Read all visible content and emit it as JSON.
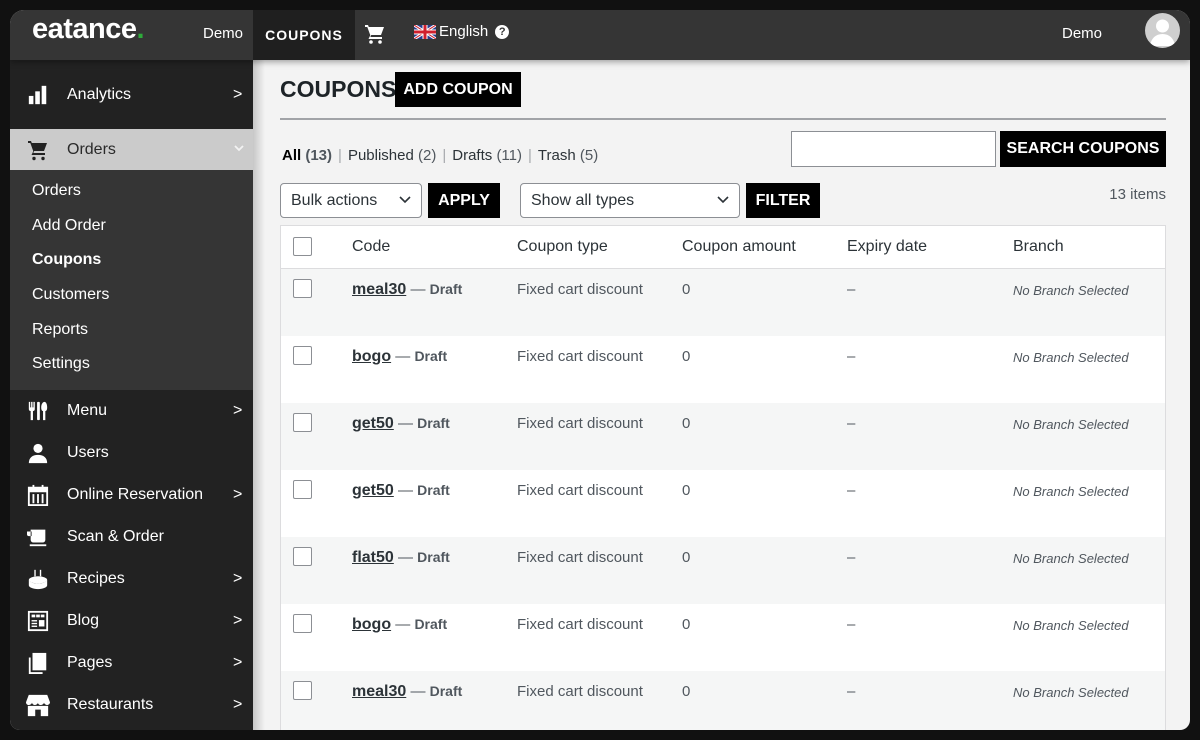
{
  "topbar": {
    "logo_text": "eatance",
    "logo_dot": ".",
    "site_name": "Demo",
    "active_tab": "COUPONS",
    "cart_icon": "cart-icon",
    "language": "English",
    "help_icon": "?",
    "user_name": "Demo",
    "avatar_icon": "user-avatar-icon"
  },
  "sidebar": {
    "items": [
      {
        "label": "Analytics",
        "icon": "bar-chart-icon",
        "has_chevron": true
      },
      {
        "label": "Orders",
        "icon": "cart-icon",
        "expanded": true
      },
      {
        "label": "Menu",
        "icon": "utensils-icon",
        "has_chevron": true
      },
      {
        "label": "Users",
        "icon": "user-icon",
        "has_chevron": false
      },
      {
        "label": "Online Reservation",
        "icon": "calendar-icon",
        "has_chevron": true
      },
      {
        "label": "Scan & Order",
        "icon": "cup-icon",
        "has_chevron": false
      },
      {
        "label": "Recipes",
        "icon": "cake-icon",
        "has_chevron": true
      },
      {
        "label": "Blog",
        "icon": "newspaper-icon",
        "has_chevron": true
      },
      {
        "label": "Pages",
        "icon": "pages-icon",
        "has_chevron": true
      },
      {
        "label": "Restaurants",
        "icon": "store-icon",
        "has_chevron": true
      }
    ],
    "orders_submenu": [
      {
        "label": "Orders"
      },
      {
        "label": "Add Order"
      },
      {
        "label": "Coupons",
        "active": true
      },
      {
        "label": "Customers"
      },
      {
        "label": "Reports"
      },
      {
        "label": "Settings"
      }
    ],
    "chevron_right": ">",
    "chevron_down": "⌄"
  },
  "main": {
    "title": "COUPONS",
    "add_button": "ADD COUPON",
    "status_filters": [
      {
        "label": "All",
        "count": "(13)",
        "current": true
      },
      {
        "label": "Published",
        "count": "(2)"
      },
      {
        "label": "Drafts",
        "count": "(11)"
      },
      {
        "label": "Trash",
        "count": "(5)"
      }
    ],
    "separator": "|",
    "search": {
      "value": "",
      "placeholder": "",
      "button": "SEARCH COUPONS"
    },
    "bulk_actions": {
      "selected": "Bulk actions",
      "apply": "APPLY"
    },
    "type_filter": {
      "selected": "Show all types",
      "button": "FILTER"
    },
    "items_count": "13 items",
    "table": {
      "columns": [
        "Code",
        "Coupon type",
        "Coupon amount",
        "Expiry date",
        "Branch"
      ],
      "rows": [
        {
          "code": "meal30",
          "status": "Draft",
          "type": "Fixed cart discount",
          "amount": "0",
          "expiry": "–",
          "branch": "No Branch Selected"
        },
        {
          "code": "bogo",
          "status": "Draft",
          "type": "Fixed cart discount",
          "amount": "0",
          "expiry": "–",
          "branch": "No Branch Selected"
        },
        {
          "code": "get50",
          "status": "Draft",
          "type": "Fixed cart discount",
          "amount": "0",
          "expiry": "–",
          "branch": "No Branch Selected"
        },
        {
          "code": "get50",
          "status": "Draft",
          "type": "Fixed cart discount",
          "amount": "0",
          "expiry": "–",
          "branch": "No Branch Selected"
        },
        {
          "code": "flat50",
          "status": "Draft",
          "type": "Fixed cart discount",
          "amount": "0",
          "expiry": "–",
          "branch": "No Branch Selected"
        },
        {
          "code": "bogo",
          "status": "Draft",
          "type": "Fixed cart discount",
          "amount": "0",
          "expiry": "–",
          "branch": "No Branch Selected"
        },
        {
          "code": "meal30",
          "status": "Draft",
          "type": "Fixed cart discount",
          "amount": "0",
          "expiry": "–",
          "branch": "No Branch Selected"
        }
      ],
      "dash": "—"
    }
  },
  "colors": {
    "topbar_bg": "#353535",
    "sidebar_bg": "#222222",
    "submenu_bg": "#353535",
    "orders_active_bg": "#cbcbcb",
    "logo_dot": "#2eaa3a",
    "button_bg": "#000000",
    "page_bg": "#f3f3f3"
  }
}
